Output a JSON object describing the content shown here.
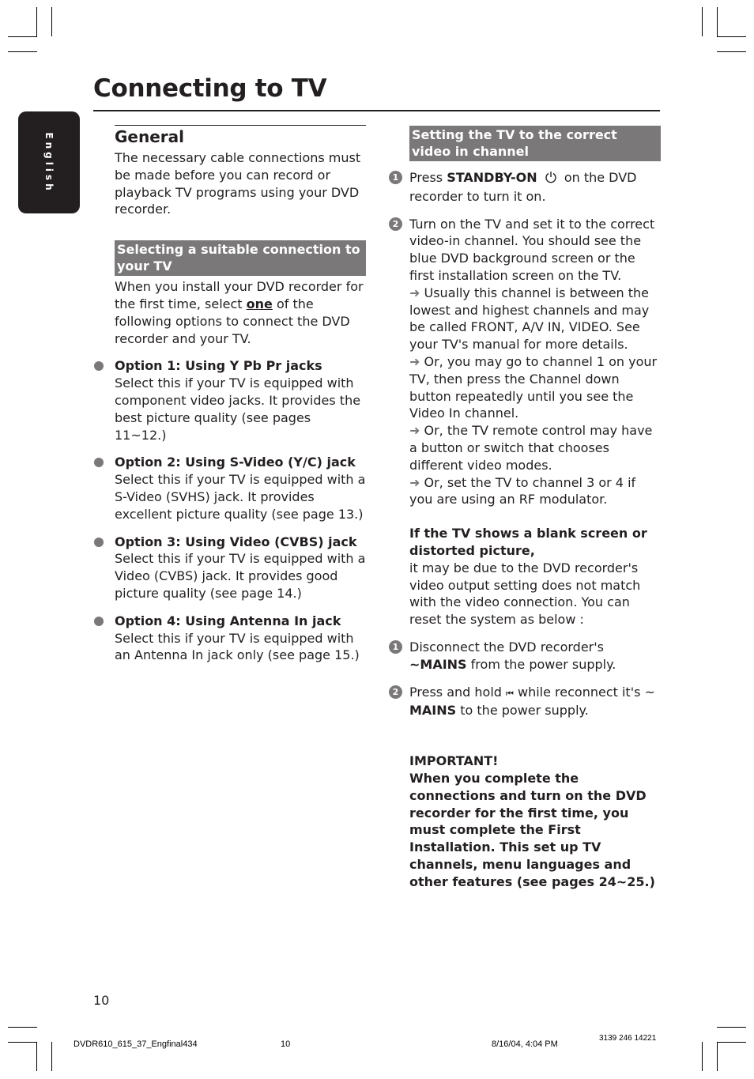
{
  "page": {
    "title": "Connecting to TV",
    "language_tab": "English",
    "page_number": "10"
  },
  "left": {
    "general_heading": "General",
    "general_text": "The necessary cable connections must be made before you can record or playback TV programs using your DVD recorder.",
    "selecting_heading": "Selecting a suitable connection to your TV",
    "selecting_text_before": "When you install your DVD recorder for the first time, select ",
    "selecting_text_emph": "one",
    "selecting_text_after": " of the following options to connect the DVD recorder and your TV.",
    "options": [
      {
        "title": "Option 1:  Using Y Pb Pr jacks",
        "text": "Select this if your TV is equipped with component video jacks.  It provides the best picture quality (see pages 11~12.)"
      },
      {
        "title": "Option 2: Using S-Video (Y/C) jack",
        "text": "Select this if your TV is equipped with a S-Video (SVHS) jack.  It provides excellent picture quality (see page 13.)"
      },
      {
        "title": "Option 3:  Using Video (CVBS) jack",
        "text": "Select this if your TV is equipped with a Video (CVBS) jack.  It provides good picture quality (see page 14.)"
      },
      {
        "title": "Option 4: Using Antenna In jack",
        "text": "Select this if your TV is equipped with an Antenna In jack only (see page 15.)"
      }
    ]
  },
  "right": {
    "setting_heading": "Setting the TV to the correct video in channel",
    "step1": {
      "num": "1",
      "pre": "Press ",
      "bold": "STANDBY-ON",
      "icon": "power-icon",
      "post": " on the DVD recorder to turn it on."
    },
    "step2": {
      "num": "2",
      "text": "Turn on the TV and set it to the correct video-in channel. You should see the blue DVD background screen or the first installation screen on the TV."
    },
    "tips": [
      "Usually this channel is between the lowest and highest channels and may be called FRONT, A/V IN, VIDEO. See your TV's manual for more details.",
      "Or, you may go to channel 1 on your TV, then press the Channel down button repeatedly until you see the Video In channel.",
      "Or, the TV remote control may have a button or switch that chooses different video modes.",
      "Or, set the TV to channel 3 or 4 if you are using an RF modulator."
    ],
    "blank_heading": "If the TV shows a blank screen or distorted picture,",
    "blank_text": "it may be due to the DVD recorder's video output setting does not match with the video connection. You can reset the system as below :",
    "reset1": {
      "num": "1",
      "pre": "Disconnect the DVD recorder's ",
      "bold": "~MAINS",
      "post": " from the power supply."
    },
    "reset2": {
      "num": "2",
      "pre": "Press and hold ",
      "icon": "previous-icon",
      "mid": " while reconnect it's ~ ",
      "bold": "MAINS",
      "post": " to the power supply."
    },
    "important_heading": "IMPORTANT!",
    "important_text": "When you complete the connections and turn on the DVD recorder for the first time, you must complete the First Installation. This set up TV channels, menu languages and other features (see pages 24~25.)"
  },
  "footer": {
    "file": "DVDR610_615_37_Engfinal434",
    "page": "10",
    "datetime": "8/16/04, 4:04 PM",
    "code": "3139 246 14221"
  }
}
